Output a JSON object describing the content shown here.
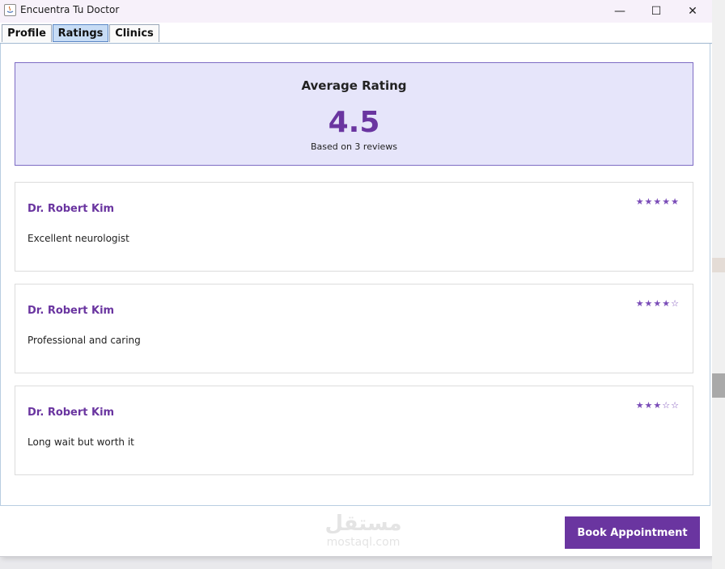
{
  "window": {
    "title": "Encuentra Tu Doctor",
    "controls": {
      "minimize": "—",
      "maximize": "☐",
      "close": "✕"
    }
  },
  "tabs": [
    {
      "label": "Profile",
      "selected": false
    },
    {
      "label": "Ratings",
      "selected": true
    },
    {
      "label": "Clinics",
      "selected": false
    }
  ],
  "summary": {
    "title": "Average Rating",
    "value": "4.5",
    "subtitle": "Based on 3 reviews"
  },
  "reviews": [
    {
      "doctor": "Dr. Robert Kim",
      "comment": "Excellent neurologist",
      "stars": "★★★★★",
      "rating": 5
    },
    {
      "doctor": "Dr. Robert Kim",
      "comment": "Professional and caring",
      "stars": "★★★★☆",
      "rating": 4
    },
    {
      "doctor": "Dr. Robert Kim",
      "comment": "Long wait but worth it",
      "stars": "★★★☆☆",
      "rating": 3
    }
  ],
  "actions": {
    "book": "Book Appointment"
  },
  "watermark": {
    "arabic": "مستقل",
    "latin": "mostaql.com"
  },
  "colors": {
    "accent": "#6a35a0",
    "summary_bg": "#e6e5fa",
    "tab_selected": "#c7dcf5"
  }
}
